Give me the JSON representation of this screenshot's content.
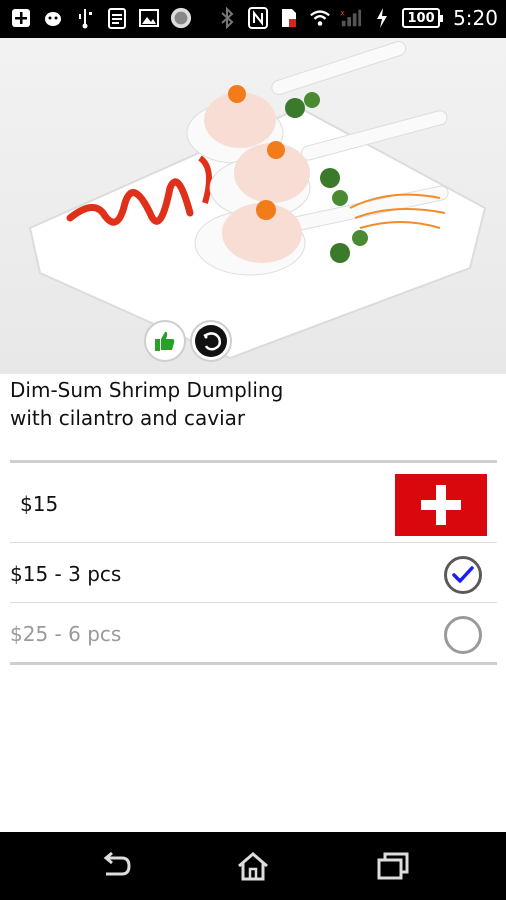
{
  "status_bar": {
    "battery_level": "100",
    "time": "5:20"
  },
  "item": {
    "title_line1": "Dim-Sum Shrimp Dumpling",
    "title_line2": "with cilantro and caviar",
    "price": "$15"
  },
  "options": [
    {
      "label": "$15 - 3 pcs",
      "selected": true,
      "color": "#111111"
    },
    {
      "label": "$25 - 6 pcs",
      "selected": false,
      "color": "#9a9a9a"
    }
  ],
  "colors": {
    "accent_red": "#d9080d",
    "check_blue": "#1a1aff",
    "thumb_green": "#2aa02a"
  },
  "icons": {
    "badge_1": "thumbs-up-icon",
    "badge_2": "shrimp-icon",
    "add": "plus-icon",
    "nav_back": "back-icon",
    "nav_home": "home-icon",
    "nav_recents": "recents-icon"
  }
}
